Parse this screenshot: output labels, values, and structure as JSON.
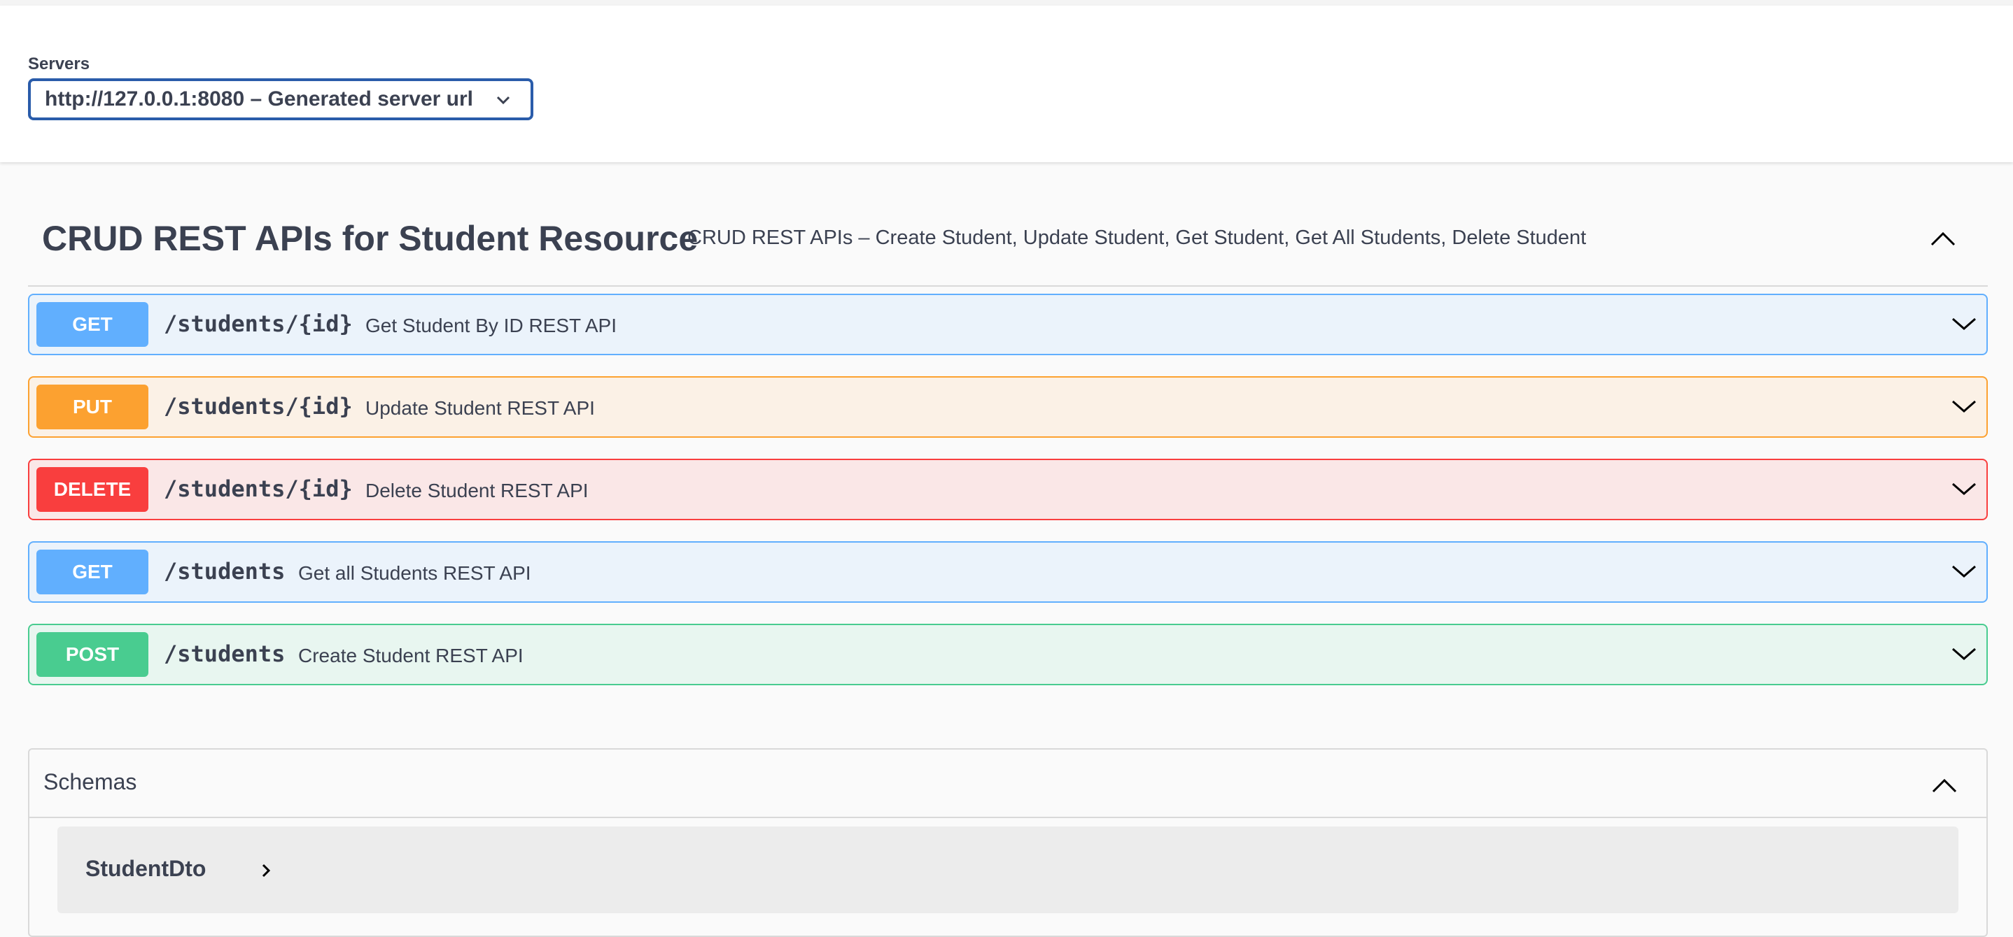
{
  "servers": {
    "label": "Servers",
    "selected": "http://127.0.0.1:8080 – Generated server url"
  },
  "tag": {
    "title": "CRUD REST APIs for Student Resource",
    "description": "CRUD REST APIs – Create Student, Update Student, Get Student, Get All Students, Delete Student"
  },
  "operations": [
    {
      "method": "GET",
      "path": "/students/{id}",
      "summary": "Get Student By ID REST API"
    },
    {
      "method": "PUT",
      "path": "/students/{id}",
      "summary": "Update Student REST API"
    },
    {
      "method": "DELETE",
      "path": "/students/{id}",
      "summary": "Delete Student REST API"
    },
    {
      "method": "GET",
      "path": "/students",
      "summary": "Get all Students REST API"
    },
    {
      "method": "POST",
      "path": "/students",
      "summary": "Create Student REST API"
    }
  ],
  "schemas": {
    "title": "Schemas",
    "models": [
      "StudentDto"
    ]
  },
  "colors": {
    "get": "#61affe",
    "put": "#fca130",
    "delete": "#f93e3e",
    "post": "#49cc90"
  }
}
